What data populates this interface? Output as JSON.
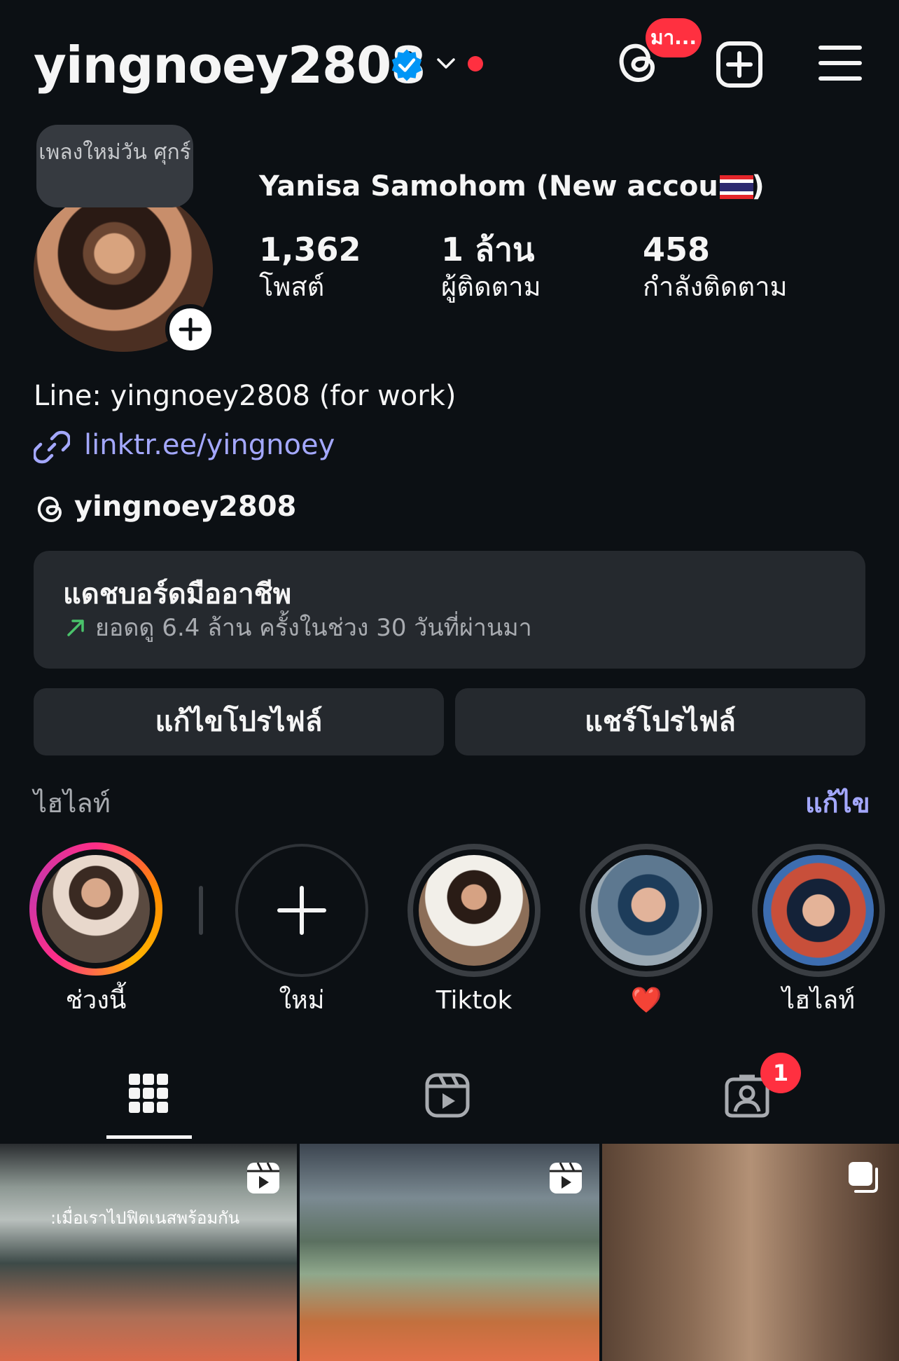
{
  "header": {
    "username": "yingnoey2808",
    "threads_badge": "มา..."
  },
  "profile": {
    "note": "เพลงใหม่วัน ศุกร์",
    "display_name": "Yanisa Samohom (New account)",
    "stats": [
      {
        "value": "1,362",
        "label": "โพสต์"
      },
      {
        "value": "1 ล้าน",
        "label": "ผู้ติดตาม"
      },
      {
        "value": "458",
        "label": "กำลังติดตาม"
      }
    ],
    "bio": "Line: yingnoey2808 (for work)",
    "link": "linktr.ee/yingnoey",
    "threads_handle": "yingnoey2808"
  },
  "dashboard": {
    "title": "แดชบอร์ดมืออาชีพ",
    "subtitle": "ยอดดู 6.4 ล้าน ครั้งในช่วง 30 วันที่ผ่านมา"
  },
  "actions": {
    "edit_profile": "แก้ไขโปรไฟล์",
    "share_profile": "แชร์โปรไฟล์"
  },
  "highlights": {
    "title": "ไฮไลท์",
    "edit": "แก้ไข",
    "items": [
      {
        "label": "ช่วงนี้"
      },
      {
        "label": "ใหม่"
      },
      {
        "label": "Tiktok"
      },
      {
        "label": "❤️"
      },
      {
        "label": "ไฮไลท์"
      }
    ]
  },
  "tabs": {
    "tagged_badge": "1"
  },
  "grid": {
    "tile1_caption": ":เมื่อเราไปฟิตเนสพร้อมกัน"
  },
  "colors": {
    "background": "#0c1014",
    "card": "#25292e",
    "accent_link": "#a4a8ff",
    "badge_red": "#ff3040",
    "verified_blue": "#0095f6"
  }
}
